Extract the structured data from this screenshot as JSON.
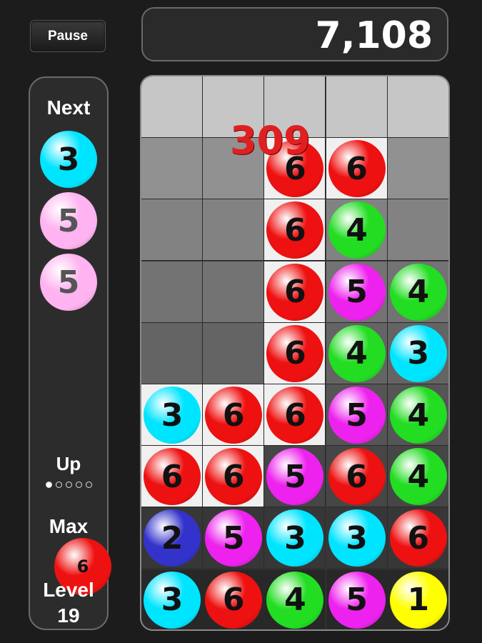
{
  "controls": {
    "pause_label": "Pause"
  },
  "score": "7,108",
  "popup_points": "309",
  "sidebar": {
    "next_label": "Next",
    "next_balls": [
      {
        "value": "3",
        "color": "#00e5ff",
        "pale": false
      },
      {
        "value": "5",
        "color": "#ffb3f0",
        "pale": true
      },
      {
        "value": "5",
        "color": "#ffb3f0",
        "pale": true
      }
    ],
    "up_label": "Up",
    "up_progress": {
      "filled": 1,
      "total": 5
    },
    "max_label": "Max",
    "max_value": "6",
    "level_label": "Level",
    "level_value": "19"
  },
  "palette": {
    "1": "#ffff00",
    "2": "#3333cc",
    "3": "#00e5ff",
    "4": "#22dd22",
    "5": "#ee22ee",
    "6": "#ee1111"
  },
  "board": {
    "cols": 5,
    "rows": 9,
    "grid": [
      [
        null,
        null,
        null,
        null,
        null
      ],
      [
        null,
        null,
        "6",
        "6",
        null
      ],
      [
        null,
        null,
        "6",
        "4",
        null
      ],
      [
        null,
        null,
        "6",
        "5",
        "4"
      ],
      [
        null,
        null,
        "6",
        "4",
        "3"
      ],
      [
        "3",
        "6",
        "6",
        "5",
        "4"
      ],
      [
        "6",
        "6",
        "5",
        "6",
        "4"
      ],
      [
        "2",
        "5",
        "3",
        "3",
        "6"
      ],
      [
        "3",
        "6",
        "4",
        "5",
        "1"
      ]
    ],
    "highlighted": [
      [
        1,
        2
      ],
      [
        1,
        3
      ],
      [
        2,
        2
      ],
      [
        3,
        2
      ],
      [
        4,
        2
      ],
      [
        5,
        0
      ],
      [
        5,
        1
      ],
      [
        5,
        2
      ],
      [
        6,
        0
      ],
      [
        6,
        1
      ]
    ]
  }
}
